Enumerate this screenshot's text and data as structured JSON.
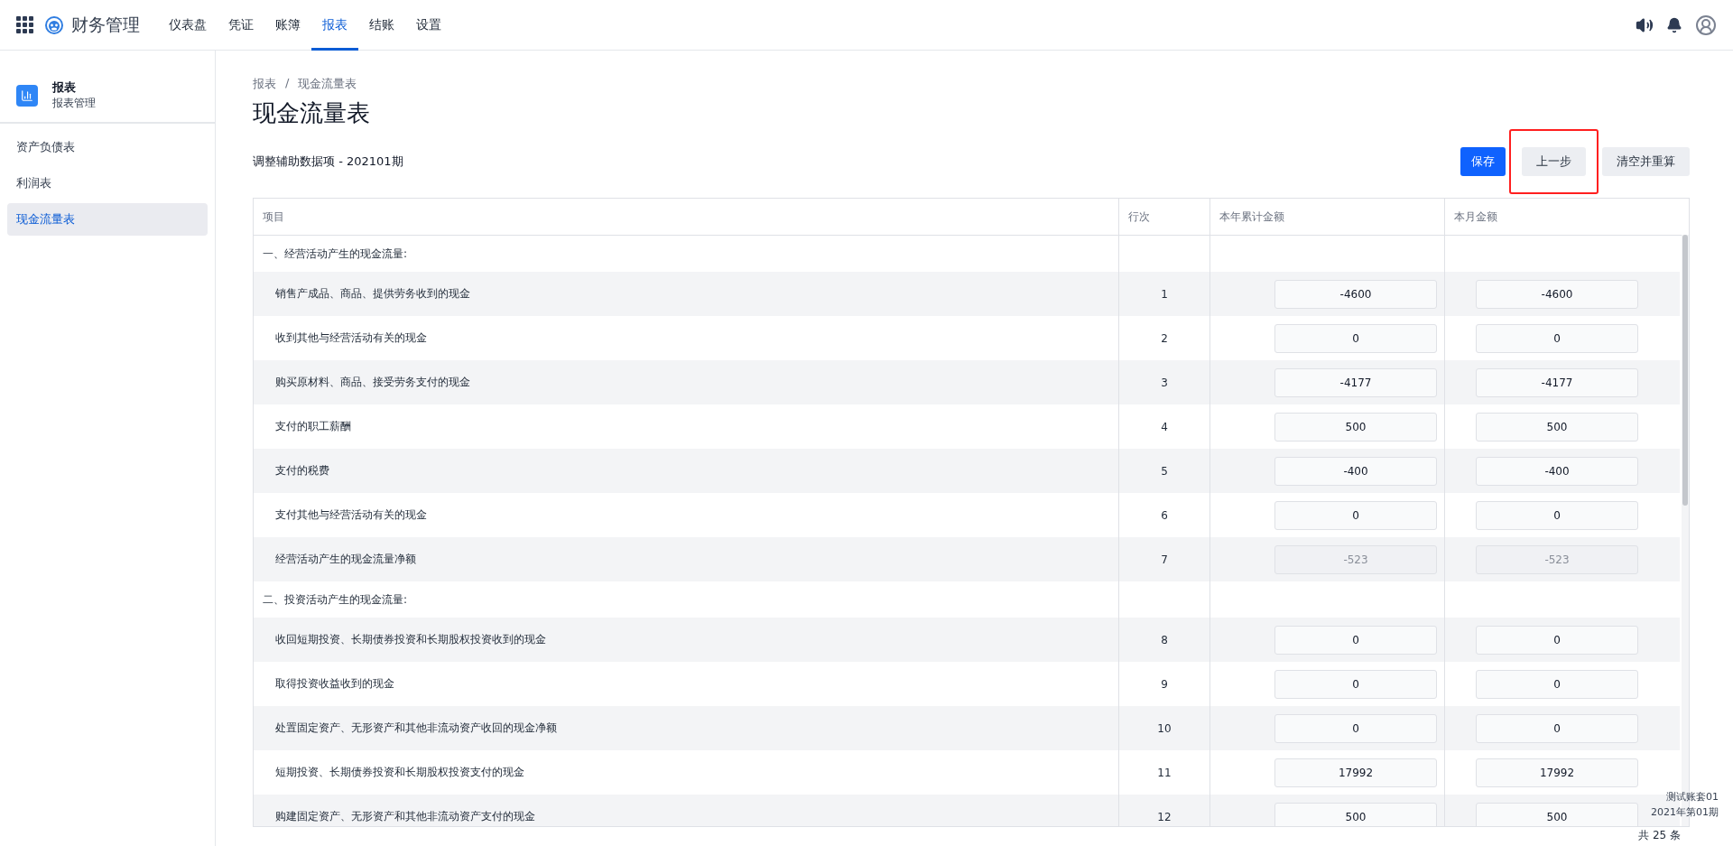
{
  "app": {
    "title": "财务管理"
  },
  "nav": [
    {
      "label": "仪表盘",
      "selected": false
    },
    {
      "label": "凭证",
      "selected": false
    },
    {
      "label": "账簿",
      "selected": false
    },
    {
      "label": "报表",
      "selected": true
    },
    {
      "label": "结账",
      "selected": false
    },
    {
      "label": "设置",
      "selected": false
    }
  ],
  "sidebar": {
    "title": "报表",
    "subtitle": "报表管理",
    "items": [
      {
        "label": "资产负债表",
        "selected": false
      },
      {
        "label": "利润表",
        "selected": false
      },
      {
        "label": "现金流量表",
        "selected": true
      }
    ]
  },
  "breadcrumb": [
    "报表",
    "现金流量表"
  ],
  "breadcrumb_separator": "/",
  "page_title": "现金流量表",
  "subtitle": "调整辅助数据项 - 202101期",
  "buttons": [
    {
      "label": "保存",
      "kind": "primary",
      "highlighted": false
    },
    {
      "label": "上一步",
      "kind": "secondary",
      "highlighted": true
    },
    {
      "label": "清空并重算",
      "kind": "secondary",
      "highlighted": false
    }
  ],
  "table": {
    "columns": [
      "项目",
      "行次",
      "本年累计金额",
      "本月金额"
    ],
    "rows": [
      {
        "kind": "section",
        "item": "一、经营活动产生的现金流量:"
      },
      {
        "kind": "item",
        "item": "销售产成品、商品、提供劳务收到的现金",
        "line": "1",
        "year": "-4600",
        "month": "-4600",
        "disabled": false
      },
      {
        "kind": "item",
        "item": "收到其他与经营活动有关的现金",
        "line": "2",
        "year": "0",
        "month": "0",
        "disabled": false
      },
      {
        "kind": "item",
        "item": "购买原材料、商品、接受劳务支付的现金",
        "line": "3",
        "year": "-4177",
        "month": "-4177",
        "disabled": false
      },
      {
        "kind": "item",
        "item": "支付的职工薪酬",
        "line": "4",
        "year": "500",
        "month": "500",
        "disabled": false
      },
      {
        "kind": "item",
        "item": "支付的税费",
        "line": "5",
        "year": "-400",
        "month": "-400",
        "disabled": false
      },
      {
        "kind": "item",
        "item": "支付其他与经营活动有关的现金",
        "line": "6",
        "year": "0",
        "month": "0",
        "disabled": false
      },
      {
        "kind": "item",
        "item": "经营活动产生的现金流量净额",
        "line": "7",
        "year": "-523",
        "month": "-523",
        "disabled": true
      },
      {
        "kind": "section",
        "item": "二、投资活动产生的现金流量:"
      },
      {
        "kind": "item",
        "item": "收回短期投资、长期债券投资和长期股权投资收到的现金",
        "line": "8",
        "year": "0",
        "month": "0",
        "disabled": false
      },
      {
        "kind": "item",
        "item": "取得投资收益收到的现金",
        "line": "9",
        "year": "0",
        "month": "0",
        "disabled": false
      },
      {
        "kind": "item",
        "item": "处置固定资产、无形资产和其他非流动资产收回的现金净额",
        "line": "10",
        "year": "0",
        "month": "0",
        "disabled": false
      },
      {
        "kind": "item",
        "item": "短期投资、长期债券投资和长期股权投资支付的现金",
        "line": "11",
        "year": "17992",
        "month": "17992",
        "disabled": false
      },
      {
        "kind": "item",
        "item": "购建固定资产、无形资产和其他非流动资产支付的现金",
        "line": "12",
        "year": "500",
        "month": "500",
        "disabled": false
      }
    ]
  },
  "account": {
    "name": "测试账套01",
    "period": "2021年第01期"
  },
  "total": "共 25 条"
}
